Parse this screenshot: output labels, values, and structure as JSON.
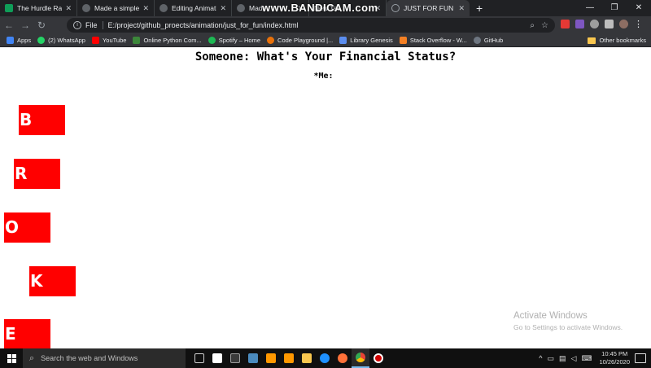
{
  "browser": {
    "tabs": [
      {
        "label": "The Hurdle Race |",
        "favicon": "green-tab-icon"
      },
      {
        "label": "Made a simple mi",
        "favicon": "github-icon"
      },
      {
        "label": "Editing Animation",
        "favicon": "github-icon"
      },
      {
        "label": "Made",
        "favicon": "github-icon"
      },
      {
        "label": "New Tab",
        "favicon": "none"
      },
      {
        "label": "JUST FOR FUN",
        "favicon": "globe-icon",
        "active": true
      }
    ],
    "new_tab_symbol": "+",
    "window_controls": [
      "—",
      "❐",
      "✕"
    ],
    "watermark": "www.BANDICAM.com",
    "address": {
      "scheme": "File",
      "url": "E:/project/github_proects/animation/just_for_fun/index.html"
    },
    "bookmarks": [
      {
        "label": "Apps",
        "icon": "apps-grid-icon",
        "color": "#4285f4"
      },
      {
        "label": "(2) WhatsApp",
        "icon": "whatsapp-icon",
        "color": "#25d366"
      },
      {
        "label": "YouTube",
        "icon": "youtube-icon",
        "color": "#ff0000"
      },
      {
        "label": "Online Python Com...",
        "icon": "python-icon",
        "color": "#3c873a"
      },
      {
        "label": "Spotify – Home",
        "icon": "spotify-icon",
        "color": "#1db954"
      },
      {
        "label": "Code Playground |...",
        "icon": "playground-icon",
        "color": "#e8710a"
      },
      {
        "label": "Library Genesis",
        "icon": "library-icon",
        "color": "#5b8def"
      },
      {
        "label": "Stack Overflow - W...",
        "icon": "stackoverflow-icon",
        "color": "#f48024"
      },
      {
        "label": "GitHub",
        "icon": "github-icon",
        "color": "#6e7681"
      }
    ],
    "other_bookmarks": "Other bookmarks"
  },
  "page": {
    "heading": "Someone: What's Your Financial Status?",
    "subheading": "*Me:",
    "letters": [
      "B",
      "R",
      "O",
      "K",
      "E"
    ],
    "letter_color": "#ff0000",
    "activation_title": "Activate Windows",
    "activation_sub": "Go to Settings to activate Windows."
  },
  "taskbar": {
    "search_placeholder": "Search the web and Windows",
    "time": "10:45 PM",
    "date": "10/26/2020",
    "apps": [
      {
        "icon": "task-view-icon",
        "color": "#cfcfcf"
      },
      {
        "icon": "store-icon",
        "color": "#ffffff"
      },
      {
        "icon": "terminal-icon",
        "color": "#3a3a3a"
      },
      {
        "icon": "python-idle-icon",
        "color": "#4b8bbe"
      },
      {
        "icon": "sublime-icon",
        "color": "#ff9800"
      },
      {
        "icon": "sublime-text-icon",
        "color": "#ff9800"
      },
      {
        "icon": "file-explorer-icon",
        "color": "#f9c74f"
      },
      {
        "icon": "edge-icon",
        "color": "#1e90ff"
      },
      {
        "icon": "firefox-icon",
        "color": "#ff7139"
      },
      {
        "icon": "chrome-icon",
        "color": "#ea4335",
        "active": true
      },
      {
        "icon": "bandicam-record-icon",
        "color": "#d00000"
      }
    ]
  }
}
